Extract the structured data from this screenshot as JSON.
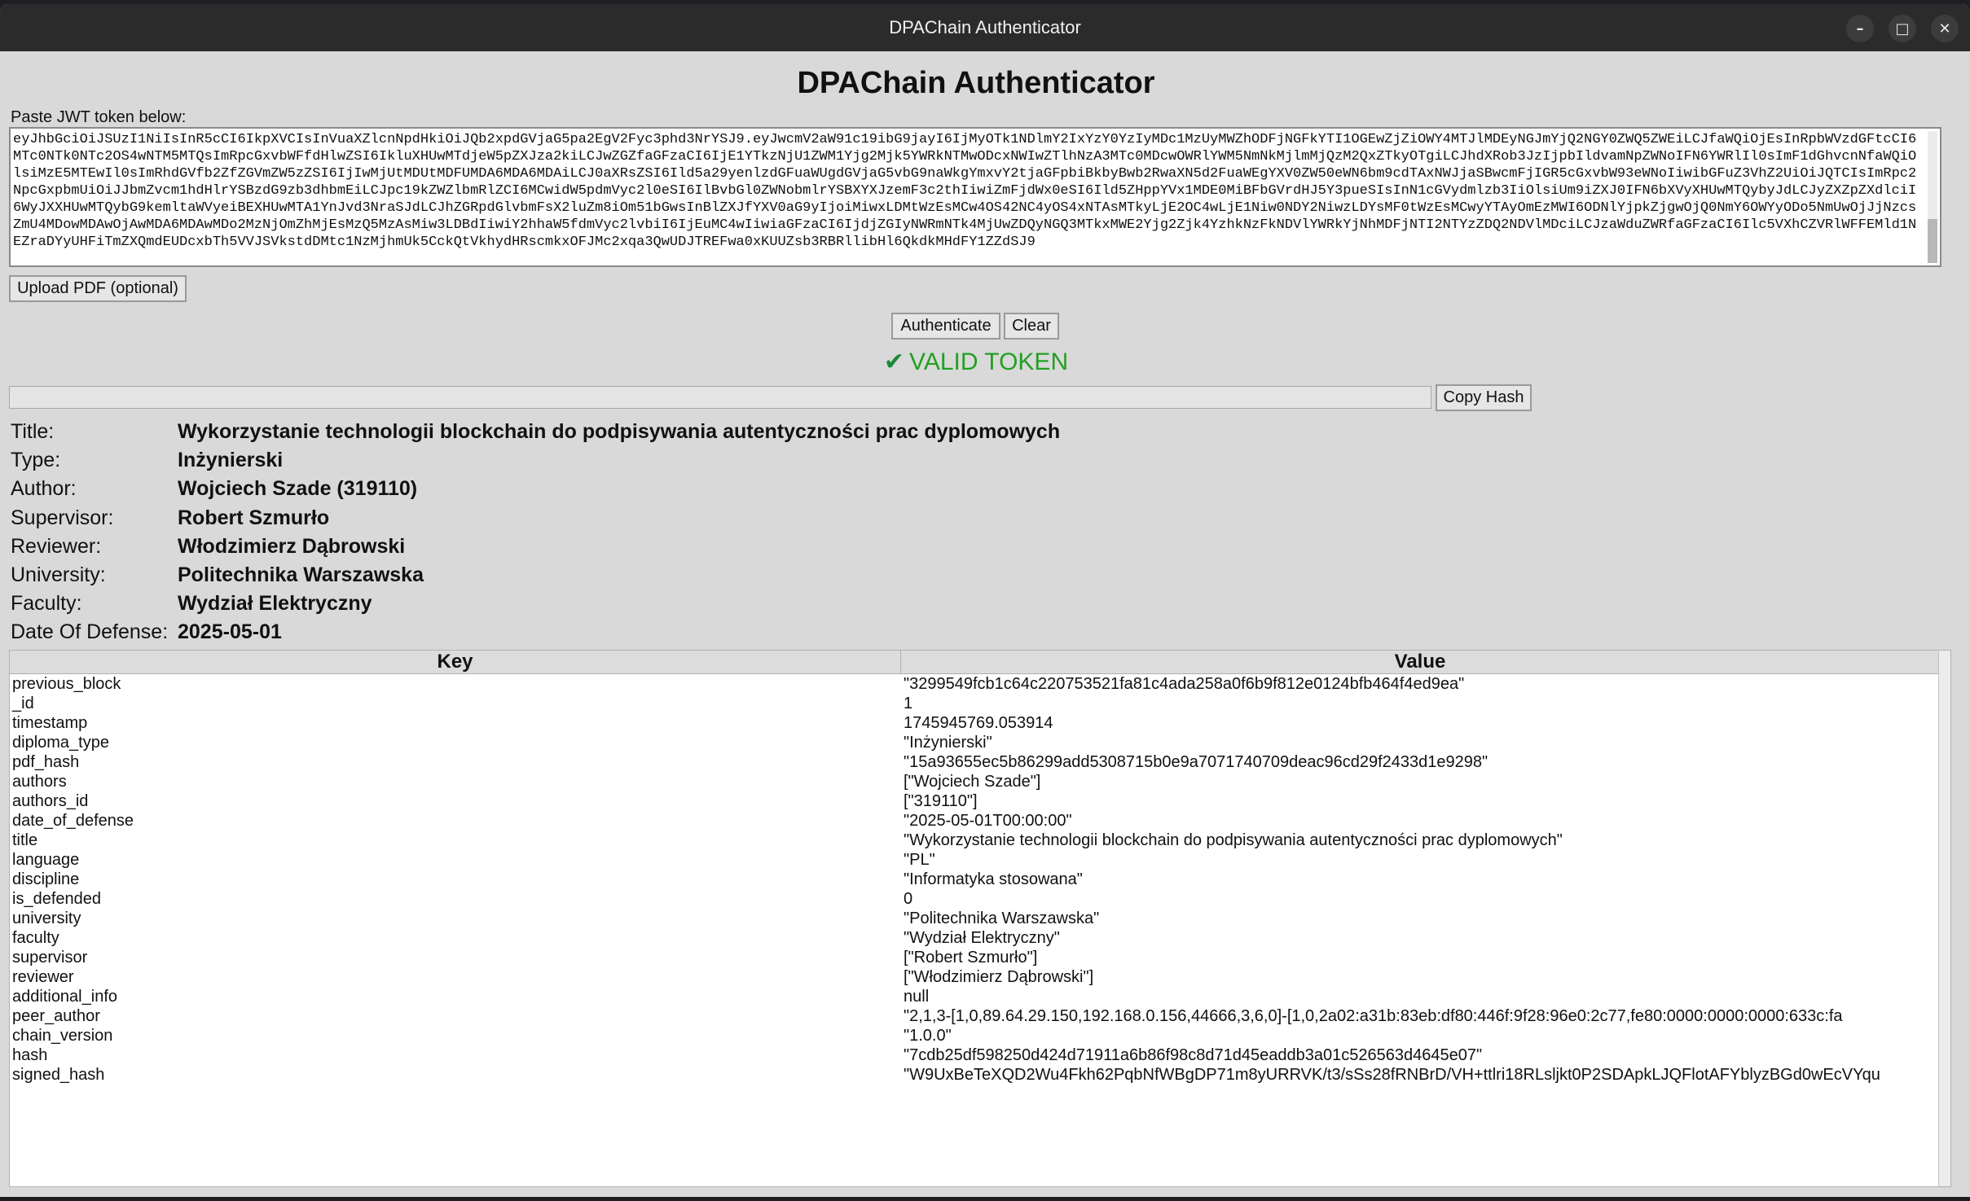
{
  "window": {
    "title": "DPAChain Authenticator"
  },
  "controls": {
    "minimize": "–",
    "maximize": "□",
    "close": "✕"
  },
  "heading": "DPAChain Authenticator",
  "jwt": {
    "label": "Paste JWT token below:",
    "token": "eyJhbGciOiJSUzI1NiIsInR5cCI6IkpXVCIsInVuaXZlcnNpdHkiOiJQb2xpdGVjaG5pa2EgV2Fyc3phd3NrYSJ9.eyJwcmV2aW91c19ibG9jayI6IjMyOTk1NDlmY2IxYzY0YzIyMDc1MzUyMWZhODFjNGFkYTI1OGEwZjZiOWY4MTJlMDEyNGJmYjQ2NGY0ZWQ5ZWEiLCJfaWQiOjEsInRpbWVzdGFtcCI6MTc0NTk0NTc2OS4wNTM5MTQsImRpcGxvbWFfdHlwZSI6IkluXHUwMTdjeW5pZXJza2kiLCJwZGZfaGFzaCI6IjE1YTkzNjU1ZWM1Yjg2Mjk5YWRkNTMwODcxNWIwZTlhNzA3MTc0MDcwOWRlYWM5NmNkMjlmMjQzM2QxZTkyOTgiLCJhdXRob3JzIjpbIldvamNpZWNoIFN6YWRlIl0sImF1dGhvcnNfaWQiOlsiMzE5MTEwIl0sImRhdGVfb2ZfZGVmZW5zZSI6IjIwMjUtMDUtMDFUMDA6MDA6MDAiLCJ0aXRsZSI6Ild5a29yenlzdGFuaWUgdGVjaG5vbG9naWkgYmxvY2tjaGFpbiBkbyBwb2RwaXN5d2FuaWEgYXV0ZW50eWN6bm9cdTAxNWJjaSBwcmFjIGR5cGxvbW93eWNoIiwibGFuZ3VhZ2UiOiJQTCIsImRpc2NpcGxpbmUiOiJJbmZvcm1hdHlrYSBzdG9zb3dhbmEiLCJpc19kZWZlbmRlZCI6MCwidW5pdmVyc2l0eSI6IlBvbGl0ZWNobmlrYSBXYXJzemF3c2thIiwiZmFjdWx0eSI6Ild5ZHppYVx1MDE0MiBFbGVrdHJ5Y3pueSIsInN1cGVydmlzb3IiOlsiUm9iZXJ0IFN6bXVyXHUwMTQybyJdLCJyZXZpZXdlciI6WyJXXHUwMTQybG9kemltaWVyeiBEXHUwMTA1YnJvd3NraSJdLCJhZGRpdGlvbmFsX2luZm8iOm51bGwsInBlZXJfYXV0aG9yIjoiMiwxLDMtWzEsMCw4OS42NC4yOS4xNTAsMTkyLjE2OC4wLjE1Niw0NDY2NiwzLDYsMF0tWzEsMCwyYTAyOmEzMWI6ODNlYjpkZjgwOjQ0NmY6OWYyODo5NmUwOjJjNzcsZmU4MDowMDAwOjAwMDA6MDAwMDo2MzNjOmZhMjEsMzQ5MzAsMiw3LDBdIiwiY2hhaW5fdmVyc2lvbiI6IjEuMC4wIiwiaGFzaCI6IjdjZGIyNWRmNTk4MjUwZDQyNGQ3MTkxMWE2Yjg2Zjk4YzhkNzFkNDVlYWRkYjNhMDFjNTI2NTYzZDQ2NDVlMDciLCJzaWduZWRfaGFzaCI6Ilc5VXhCZVRlWFFEMld1NEZraDYyUHFiTmZXQmdEUDcxbTh5VVJSVkstdDMtc1NzMjhmUk5CckQtVkhydHRscmkxOFJMc2xqa3QwUDJTREFwa0xKUUZsb3RBRllibHl6QkdkMHdFY1ZZdSJ9"
  },
  "buttons": {
    "upload": "Upload PDF (optional)",
    "authenticate": "Authenticate",
    "clear": "Clear",
    "copy_hash": "Copy Hash"
  },
  "status": {
    "icon": "✔",
    "text": "VALID TOKEN",
    "color": "#22a022"
  },
  "hash_field": {
    "value": ""
  },
  "info": [
    {
      "label": "Title:",
      "value": "Wykorzystanie technologii blockchain do podpisywania autentyczności prac dyplomowych"
    },
    {
      "label": "Type:",
      "value": "Inżynierski"
    },
    {
      "label": "Author:",
      "value": "Wojciech Szade (319110)"
    },
    {
      "label": "Supervisor:",
      "value": "Robert Szmurło"
    },
    {
      "label": "Reviewer:",
      "value": "Włodzimierz Dąbrowski"
    },
    {
      "label": "University:",
      "value": "Politechnika Warszawska"
    },
    {
      "label": "Faculty:",
      "value": "Wydział Elektryczny"
    },
    {
      "label": "Date Of Defense:",
      "value": "2025-05-01"
    }
  ],
  "table": {
    "headers": {
      "key": "Key",
      "value": "Value"
    },
    "rows": [
      {
        "key": "previous_block",
        "value": "\"3299549fcb1c64c220753521fa81c4ada258a0f6b9f812e0124bfb464f4ed9ea\""
      },
      {
        "key": "_id",
        "value": "1"
      },
      {
        "key": "timestamp",
        "value": "1745945769.053914"
      },
      {
        "key": "diploma_type",
        "value": "\"Inżynierski\""
      },
      {
        "key": "pdf_hash",
        "value": "\"15a93655ec5b86299add5308715b0e9a7071740709deac96cd29f2433d1e9298\""
      },
      {
        "key": "authors",
        "value": "[\"Wojciech Szade\"]"
      },
      {
        "key": "authors_id",
        "value": "[\"319110\"]"
      },
      {
        "key": "date_of_defense",
        "value": "\"2025-05-01T00:00:00\""
      },
      {
        "key": "title",
        "value": "\"Wykorzystanie technologii blockchain do podpisywania autentyczności prac dyplomowych\""
      },
      {
        "key": "language",
        "value": "\"PL\""
      },
      {
        "key": "discipline",
        "value": "\"Informatyka stosowana\""
      },
      {
        "key": "is_defended",
        "value": "0"
      },
      {
        "key": "university",
        "value": "\"Politechnika Warszawska\""
      },
      {
        "key": "faculty",
        "value": "\"Wydział Elektryczny\""
      },
      {
        "key": "supervisor",
        "value": "[\"Robert Szmurło\"]"
      },
      {
        "key": "reviewer",
        "value": "[\"Włodzimierz Dąbrowski\"]"
      },
      {
        "key": "additional_info",
        "value": "null"
      },
      {
        "key": "peer_author",
        "value": "\"2,1,3-[1,0,89.64.29.150,192.168.0.156,44666,3,6,0]-[1,0,2a02:a31b:83eb:df80:446f:9f28:96e0:2c77,fe80:0000:0000:0000:633c:fa"
      },
      {
        "key": "chain_version",
        "value": "\"1.0.0\""
      },
      {
        "key": "hash",
        "value": "\"7cdb25df598250d424d71911a6b86f98c8d71d45eaddb3a01c526563d4645e07\""
      },
      {
        "key": "signed_hash",
        "value": "\"W9UxBeTeXQD2Wu4Fkh62PqbNfWBgDP71m8yURRVK/t3/sSs28fRNBrD/VH+ttlri18RLsljkt0P2SDApkLJQFlotAFYblyzBGd0wEcVYqu"
      }
    ]
  }
}
